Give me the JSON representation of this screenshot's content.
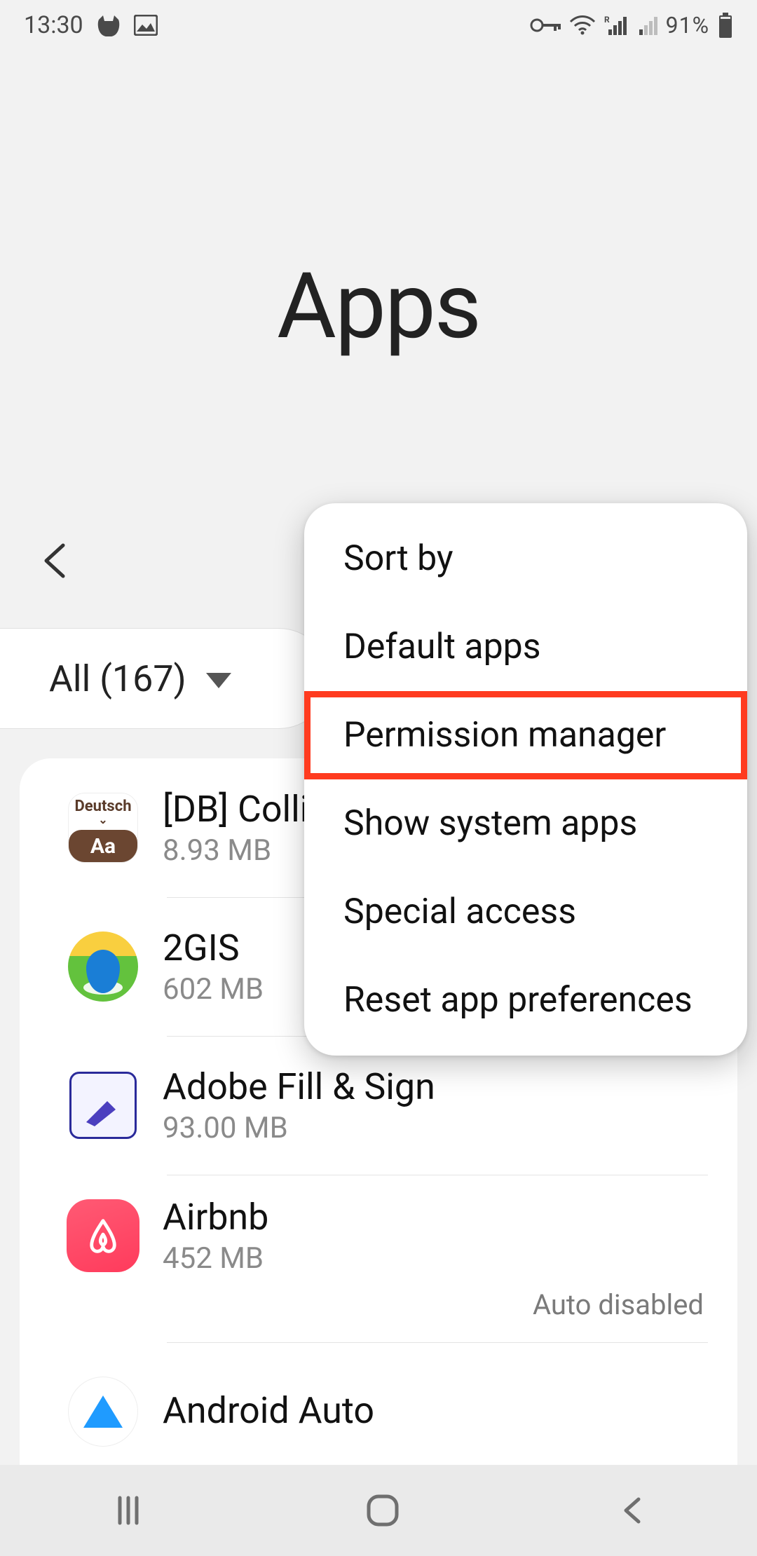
{
  "status": {
    "time": "13:30",
    "battery_text": "91%"
  },
  "page": {
    "title": "Apps"
  },
  "filter": {
    "label": "All (167)"
  },
  "apps": [
    {
      "name": "[DB] Collin",
      "size": "8.93 MB",
      "aux": ""
    },
    {
      "name": "2GIS",
      "size": "602 MB",
      "aux": ""
    },
    {
      "name": "Adobe Fill & Sign",
      "size": "93.00 MB",
      "aux": ""
    },
    {
      "name": "Airbnb",
      "size": "452 MB",
      "aux": "Auto disabled"
    },
    {
      "name": "Android Auto",
      "size": "",
      "aux": ""
    }
  ],
  "menu": {
    "items": [
      "Sort by",
      "Default apps",
      "Permission manager",
      "Show system apps",
      "Special access",
      "Reset app preferences"
    ],
    "highlighted_index": 2
  }
}
